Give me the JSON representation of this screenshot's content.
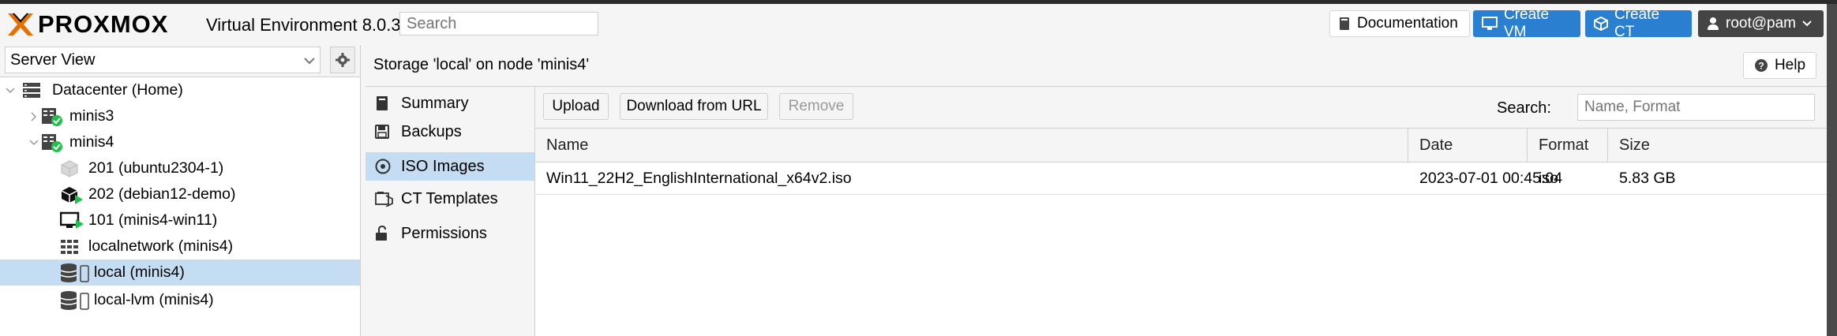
{
  "header": {
    "product_name": "PROXMOX",
    "version_text": "Virtual Environment 8.0.3",
    "search_placeholder": "Search",
    "documentation_label": "Documentation",
    "create_vm_label": "Create VM",
    "create_ct_label": "Create CT",
    "user_label": "root@pam"
  },
  "sidebar": {
    "view_label": "Server View",
    "tree": [
      {
        "label": "Datacenter (Home)",
        "icon": "datacenter-icon",
        "expanded": true
      },
      {
        "label": "minis3",
        "icon": "node-online-icon",
        "expanded": false
      },
      {
        "label": "minis4",
        "icon": "node-online-icon",
        "expanded": true
      },
      {
        "label": "201 (ubuntu2304-1)",
        "icon": "ct-stopped-icon"
      },
      {
        "label": "202 (debian12-demo)",
        "icon": "ct-running-icon"
      },
      {
        "label": "101 (minis4-win11)",
        "icon": "vm-running-icon"
      },
      {
        "label": "localnetwork (minis4)",
        "icon": "sdn-grid-icon"
      },
      {
        "label": "local (minis4)",
        "icon": "storage-icon",
        "selected": true
      },
      {
        "label": "local-lvm (minis4)",
        "icon": "storage-icon"
      }
    ]
  },
  "main": {
    "title": "Storage 'local' on node 'minis4'",
    "help_label": "Help",
    "submenu": [
      {
        "label": "Summary",
        "icon": "book-icon"
      },
      {
        "label": "Backups",
        "icon": "floppy-icon"
      },
      {
        "label": "ISO Images",
        "icon": "disc-icon",
        "active": true
      },
      {
        "label": "CT Templates",
        "icon": "template-icon"
      },
      {
        "label": "Permissions",
        "icon": "unlock-icon"
      }
    ],
    "toolbar": {
      "upload_label": "Upload",
      "download_label": "Download from URL",
      "remove_label": "Remove",
      "search_label": "Search:",
      "search_placeholder": "Name, Format"
    },
    "table": {
      "columns": [
        "Name",
        "Date",
        "Format",
        "Size"
      ],
      "rows": [
        {
          "name": "Win11_22H2_EnglishInternational_x64v2.iso",
          "date": "2023-07-01 00:45:04",
          "format": "iso",
          "size": "5.83 GB"
        }
      ]
    }
  },
  "colors": {
    "accent_blue": "#2a7fd0",
    "selection_blue": "#c5ddf2",
    "brand_orange": "#e57000",
    "status_green": "#21bf4b"
  }
}
